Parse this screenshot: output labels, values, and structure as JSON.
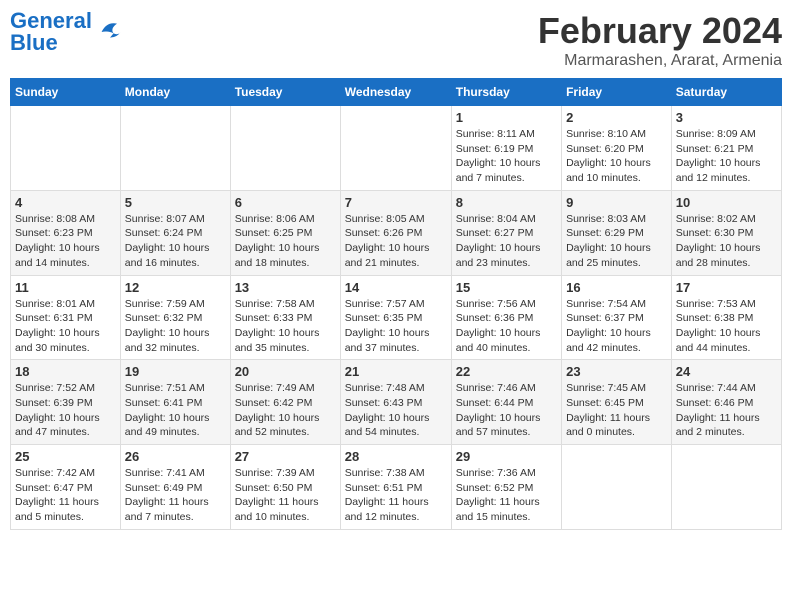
{
  "logo": {
    "text_general": "General",
    "text_blue": "Blue"
  },
  "title": "February 2024",
  "subtitle": "Marmarashen, Ararat, Armenia",
  "weekdays": [
    "Sunday",
    "Monday",
    "Tuesday",
    "Wednesday",
    "Thursday",
    "Friday",
    "Saturday"
  ],
  "weeks": [
    [
      {
        "day": "",
        "info": ""
      },
      {
        "day": "",
        "info": ""
      },
      {
        "day": "",
        "info": ""
      },
      {
        "day": "",
        "info": ""
      },
      {
        "day": "1",
        "info": "Sunrise: 8:11 AM\nSunset: 6:19 PM\nDaylight: 10 hours\nand 7 minutes."
      },
      {
        "day": "2",
        "info": "Sunrise: 8:10 AM\nSunset: 6:20 PM\nDaylight: 10 hours\nand 10 minutes."
      },
      {
        "day": "3",
        "info": "Sunrise: 8:09 AM\nSunset: 6:21 PM\nDaylight: 10 hours\nand 12 minutes."
      }
    ],
    [
      {
        "day": "4",
        "info": "Sunrise: 8:08 AM\nSunset: 6:23 PM\nDaylight: 10 hours\nand 14 minutes."
      },
      {
        "day": "5",
        "info": "Sunrise: 8:07 AM\nSunset: 6:24 PM\nDaylight: 10 hours\nand 16 minutes."
      },
      {
        "day": "6",
        "info": "Sunrise: 8:06 AM\nSunset: 6:25 PM\nDaylight: 10 hours\nand 18 minutes."
      },
      {
        "day": "7",
        "info": "Sunrise: 8:05 AM\nSunset: 6:26 PM\nDaylight: 10 hours\nand 21 minutes."
      },
      {
        "day": "8",
        "info": "Sunrise: 8:04 AM\nSunset: 6:27 PM\nDaylight: 10 hours\nand 23 minutes."
      },
      {
        "day": "9",
        "info": "Sunrise: 8:03 AM\nSunset: 6:29 PM\nDaylight: 10 hours\nand 25 minutes."
      },
      {
        "day": "10",
        "info": "Sunrise: 8:02 AM\nSunset: 6:30 PM\nDaylight: 10 hours\nand 28 minutes."
      }
    ],
    [
      {
        "day": "11",
        "info": "Sunrise: 8:01 AM\nSunset: 6:31 PM\nDaylight: 10 hours\nand 30 minutes."
      },
      {
        "day": "12",
        "info": "Sunrise: 7:59 AM\nSunset: 6:32 PM\nDaylight: 10 hours\nand 32 minutes."
      },
      {
        "day": "13",
        "info": "Sunrise: 7:58 AM\nSunset: 6:33 PM\nDaylight: 10 hours\nand 35 minutes."
      },
      {
        "day": "14",
        "info": "Sunrise: 7:57 AM\nSunset: 6:35 PM\nDaylight: 10 hours\nand 37 minutes."
      },
      {
        "day": "15",
        "info": "Sunrise: 7:56 AM\nSunset: 6:36 PM\nDaylight: 10 hours\nand 40 minutes."
      },
      {
        "day": "16",
        "info": "Sunrise: 7:54 AM\nSunset: 6:37 PM\nDaylight: 10 hours\nand 42 minutes."
      },
      {
        "day": "17",
        "info": "Sunrise: 7:53 AM\nSunset: 6:38 PM\nDaylight: 10 hours\nand 44 minutes."
      }
    ],
    [
      {
        "day": "18",
        "info": "Sunrise: 7:52 AM\nSunset: 6:39 PM\nDaylight: 10 hours\nand 47 minutes."
      },
      {
        "day": "19",
        "info": "Sunrise: 7:51 AM\nSunset: 6:41 PM\nDaylight: 10 hours\nand 49 minutes."
      },
      {
        "day": "20",
        "info": "Sunrise: 7:49 AM\nSunset: 6:42 PM\nDaylight: 10 hours\nand 52 minutes."
      },
      {
        "day": "21",
        "info": "Sunrise: 7:48 AM\nSunset: 6:43 PM\nDaylight: 10 hours\nand 54 minutes."
      },
      {
        "day": "22",
        "info": "Sunrise: 7:46 AM\nSunset: 6:44 PM\nDaylight: 10 hours\nand 57 minutes."
      },
      {
        "day": "23",
        "info": "Sunrise: 7:45 AM\nSunset: 6:45 PM\nDaylight: 11 hours\nand 0 minutes."
      },
      {
        "day": "24",
        "info": "Sunrise: 7:44 AM\nSunset: 6:46 PM\nDaylight: 11 hours\nand 2 minutes."
      }
    ],
    [
      {
        "day": "25",
        "info": "Sunrise: 7:42 AM\nSunset: 6:47 PM\nDaylight: 11 hours\nand 5 minutes."
      },
      {
        "day": "26",
        "info": "Sunrise: 7:41 AM\nSunset: 6:49 PM\nDaylight: 11 hours\nand 7 minutes."
      },
      {
        "day": "27",
        "info": "Sunrise: 7:39 AM\nSunset: 6:50 PM\nDaylight: 11 hours\nand 10 minutes."
      },
      {
        "day": "28",
        "info": "Sunrise: 7:38 AM\nSunset: 6:51 PM\nDaylight: 11 hours\nand 12 minutes."
      },
      {
        "day": "29",
        "info": "Sunrise: 7:36 AM\nSunset: 6:52 PM\nDaylight: 11 hours\nand 15 minutes."
      },
      {
        "day": "",
        "info": ""
      },
      {
        "day": "",
        "info": ""
      }
    ]
  ]
}
